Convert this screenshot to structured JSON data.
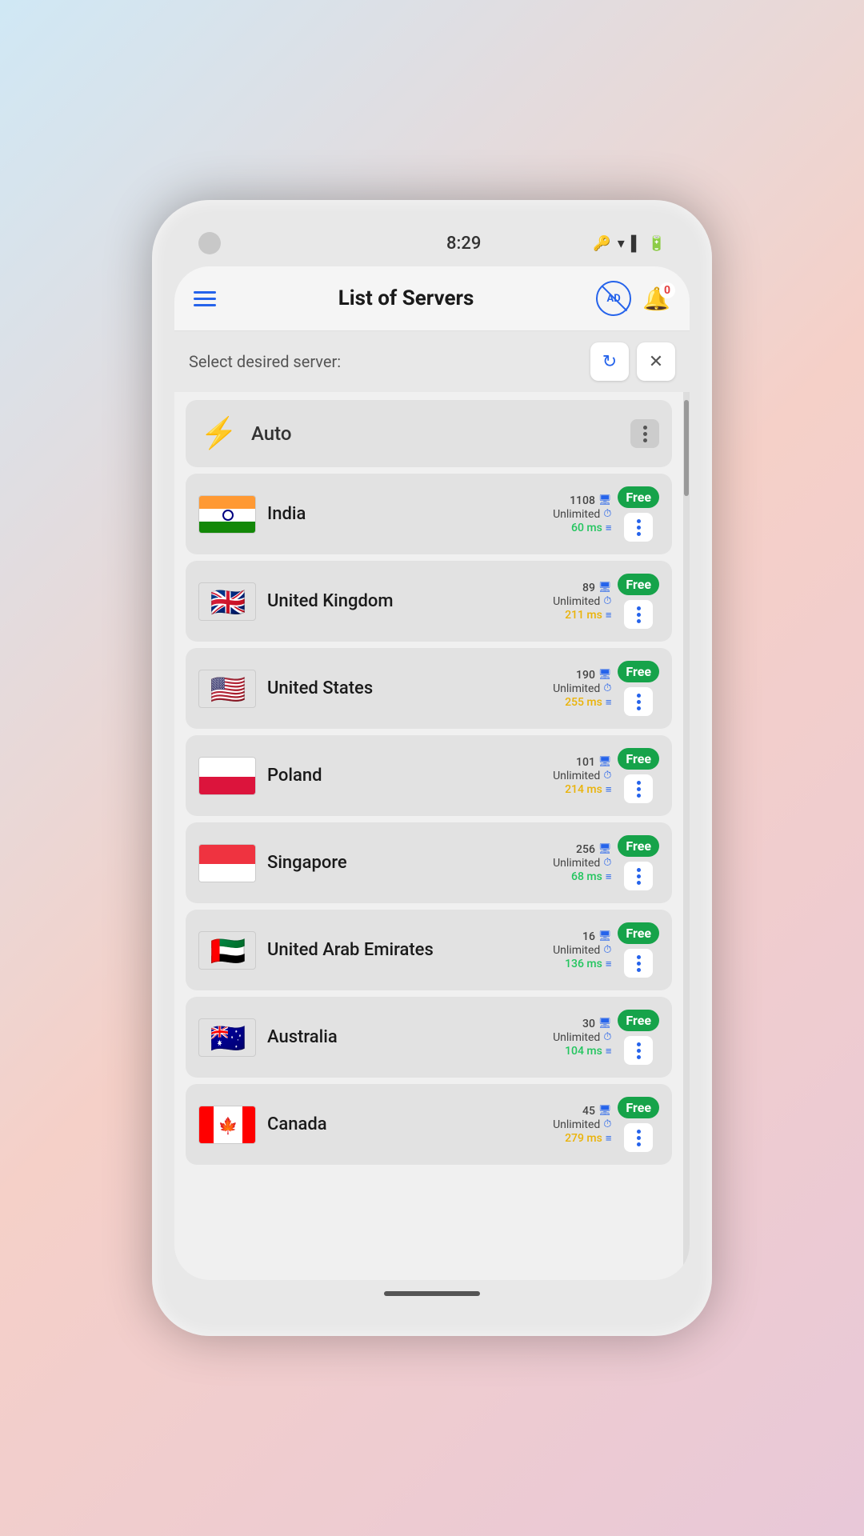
{
  "statusBar": {
    "time": "8:29"
  },
  "header": {
    "title": "List of Servers",
    "notificationCount": "0"
  },
  "filterBar": {
    "label": "Select desired server:"
  },
  "autoServer": {
    "name": "Auto"
  },
  "servers": [
    {
      "id": "india",
      "name": "India",
      "count": "1108",
      "bandwidth": "Unlimited",
      "latency": "60 ms",
      "latencyColor": "green",
      "badge": "Free",
      "flagEmoji": "🇮🇳"
    },
    {
      "id": "uk",
      "name": "United Kingdom",
      "count": "89",
      "bandwidth": "Unlimited",
      "latency": "211 ms",
      "latencyColor": "yellow",
      "badge": "Free",
      "flagEmoji": "🇬🇧"
    },
    {
      "id": "us",
      "name": "United States",
      "count": "190",
      "bandwidth": "Unlimited",
      "latency": "255 ms",
      "latencyColor": "yellow",
      "badge": "Free",
      "flagEmoji": "🇺🇸"
    },
    {
      "id": "poland",
      "name": "Poland",
      "count": "101",
      "bandwidth": "Unlimited",
      "latency": "214 ms",
      "latencyColor": "yellow",
      "badge": "Free",
      "flagEmoji": "🇵🇱"
    },
    {
      "id": "singapore",
      "name": "Singapore",
      "count": "256",
      "bandwidth": "Unlimited",
      "latency": "68 ms",
      "latencyColor": "green",
      "badge": "Free",
      "flagEmoji": "🇸🇬"
    },
    {
      "id": "uae",
      "name": "United Arab Emirates",
      "count": "16",
      "bandwidth": "Unlimited",
      "latency": "136 ms",
      "latencyColor": "green",
      "badge": "Free",
      "flagEmoji": "🇦🇪"
    },
    {
      "id": "australia",
      "name": "Australia",
      "count": "30",
      "bandwidth": "Unlimited",
      "latency": "104 ms",
      "latencyColor": "green",
      "badge": "Free",
      "flagEmoji": "🇦🇺"
    },
    {
      "id": "canada",
      "name": "Canada",
      "count": "45",
      "bandwidth": "Unlimited",
      "latency": "279 ms",
      "latencyColor": "yellow",
      "badge": "Free",
      "flagEmoji": "🇨🇦"
    }
  ],
  "icons": {
    "hamburger": "☰",
    "refresh": "↻",
    "close": "✕",
    "lightning": "⚡",
    "bell": "🔔",
    "monitor": "🖥",
    "clock": "⏱",
    "server": "≡"
  }
}
